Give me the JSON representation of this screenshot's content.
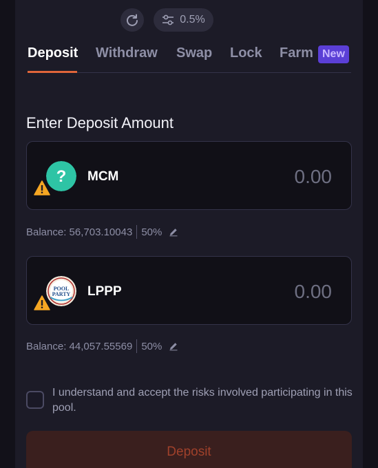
{
  "header": {
    "refresh_icon": "refresh-icon",
    "slippage_icon": "sliders-icon",
    "slippage_value": "0.5%"
  },
  "tabs": [
    {
      "label": "Deposit",
      "active": true
    },
    {
      "label": "Withdraw",
      "active": false
    },
    {
      "label": "Swap",
      "active": false
    },
    {
      "label": "Lock",
      "active": false
    },
    {
      "label": "Farm",
      "active": false,
      "badge": "New"
    }
  ],
  "section_title": "Enter Deposit Amount",
  "tokens": [
    {
      "symbol": "MCM",
      "icon": "question-mark-icon",
      "warning_icon": "warning-icon",
      "amount_placeholder": "0.00",
      "balance_label": "Balance:",
      "balance": "56,703.10043",
      "percent": "50%",
      "edit_icon": "pencil-icon"
    },
    {
      "symbol": "LPPP",
      "icon": "pool-party-logo",
      "logo_text": "POOL PARTY",
      "warning_icon": "warning-icon",
      "amount_placeholder": "0.00",
      "balance_label": "Balance:",
      "balance": "44,057.55569",
      "percent": "50%",
      "edit_icon": "pencil-icon"
    }
  ],
  "consent_text": "I understand and accept the risks involved participating in this pool.",
  "deposit_button": "Deposit",
  "colors": {
    "accent": "#e0653a",
    "badge": "#5b3fd6",
    "token_mcm": "#2ec4a5",
    "warning": "#f5a623"
  }
}
